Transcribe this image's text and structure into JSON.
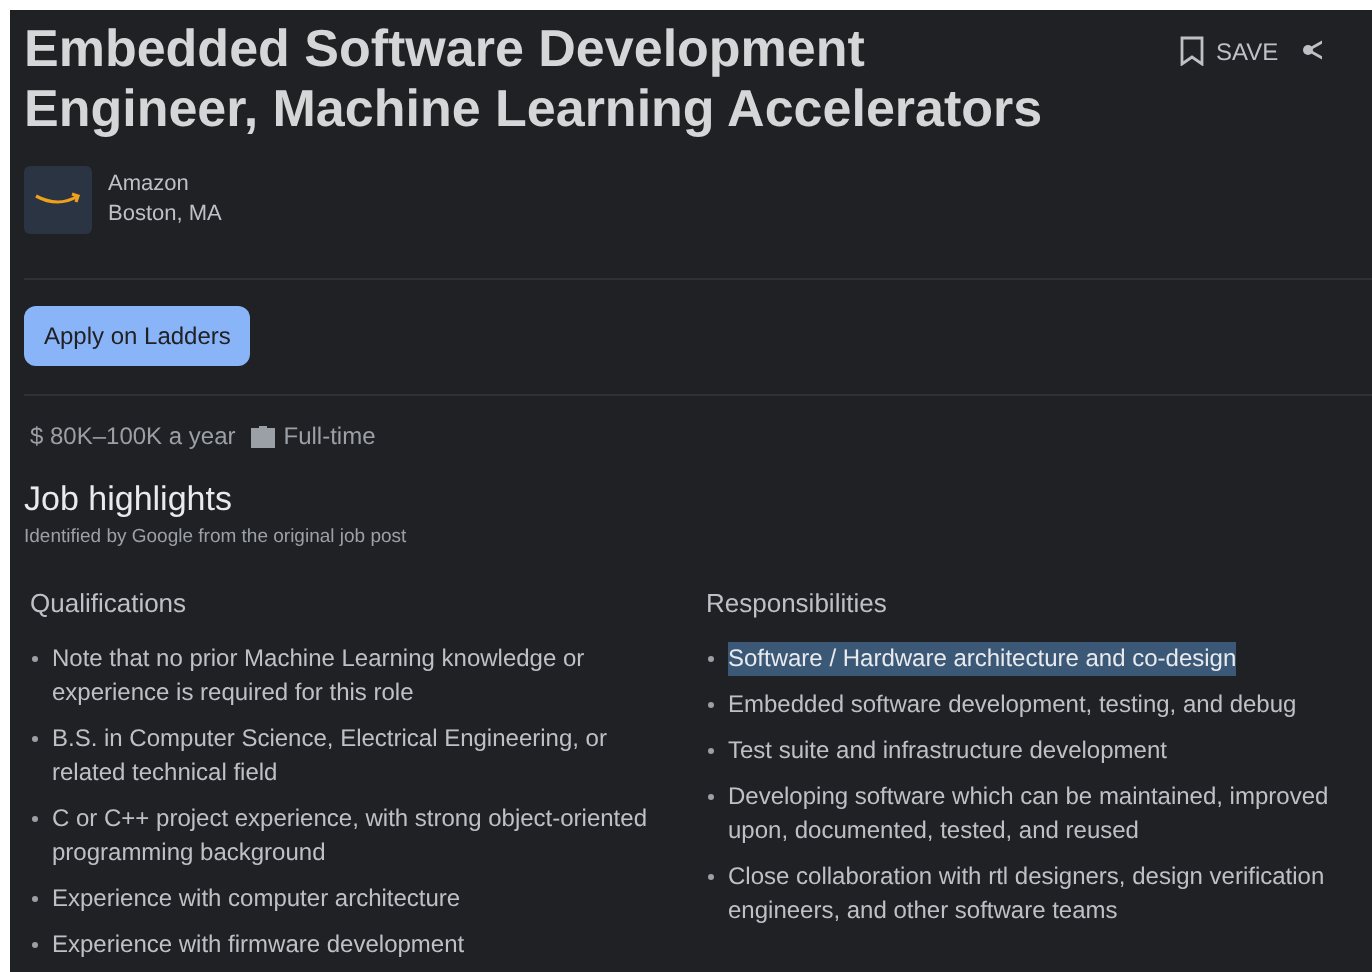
{
  "title": "Embedded Software Development Engineer, Machine Learning Accelerators",
  "save_button": "SAVE",
  "company": {
    "name": "Amazon",
    "location": "Boston, MA"
  },
  "apply_button": "Apply on Ladders",
  "salary": "$ 80K–100K a year",
  "job_type": "Full-time",
  "highlights": {
    "title": "Job highlights",
    "subtitle": "Identified by Google from the original job post",
    "columns": [
      {
        "heading": "Qualifications",
        "items": [
          {
            "text": "Note that no prior Machine Learning knowledge or experience is required for this role",
            "selected": false
          },
          {
            "text": "B.S. in Computer Science, Electrical Engineering, or related technical field",
            "selected": false
          },
          {
            "text": "C or C++ project experience, with strong object-oriented programming background",
            "selected": false
          },
          {
            "text": "Experience with computer architecture",
            "selected": false
          },
          {
            "text": "Experience with firmware development",
            "selected": false
          }
        ]
      },
      {
        "heading": "Responsibilities",
        "items": [
          {
            "text": "Software / Hardware architecture and co-design",
            "selected": true
          },
          {
            "text": "Embedded software development, testing, and debug",
            "selected": false
          },
          {
            "text": "Test suite and infrastructure development",
            "selected": false
          },
          {
            "text": "Developing software which can be maintained, improved upon, documented, tested, and reused",
            "selected": false
          },
          {
            "text": "Close collaboration with rtl designers, design verification engineers, and other software teams",
            "selected": false
          }
        ]
      }
    ]
  }
}
